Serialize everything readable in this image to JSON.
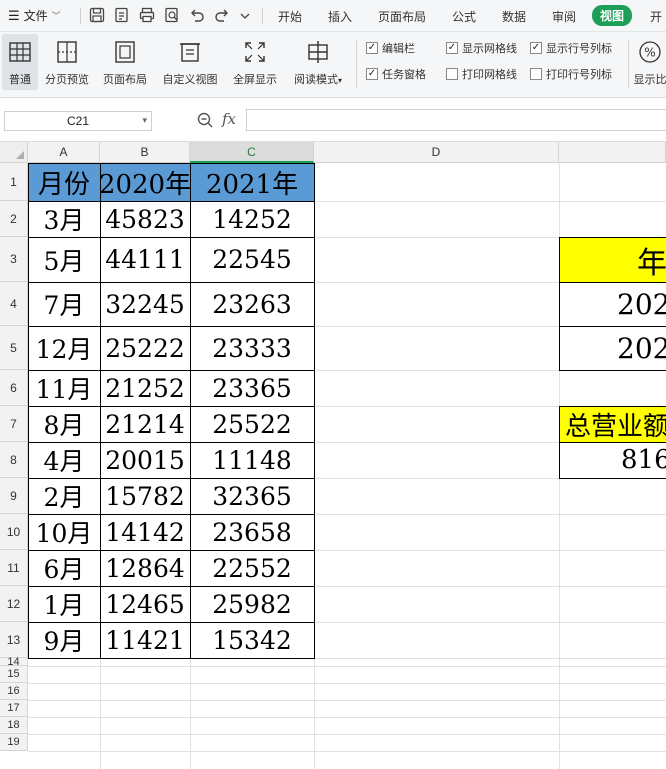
{
  "menubar": {
    "file_label": "文件",
    "tabs": [
      "开始",
      "插入",
      "页面布局",
      "公式",
      "数据",
      "审阅",
      "视图",
      "开"
    ],
    "active_tab": "视图"
  },
  "ribbon": {
    "buttons": [
      "普通",
      "分页预览",
      "页面布局",
      "自定义视图",
      "全屏显示",
      "阅读模式"
    ],
    "checks": [
      {
        "label": "编辑栏",
        "checked": true
      },
      {
        "label": "任务窗格",
        "checked": true
      },
      {
        "label": "显示网格线",
        "checked": true
      },
      {
        "label": "打印网格线",
        "checked": false
      },
      {
        "label": "显示行号列标",
        "checked": true
      },
      {
        "label": "打印行号列标",
        "checked": false
      }
    ],
    "zoom_label": "显示比"
  },
  "formula_bar": {
    "name_box": "C21",
    "fx": "fx",
    "formula": ""
  },
  "columns": [
    "A",
    "B",
    "C",
    "D"
  ],
  "rows": [
    "1",
    "2",
    "3",
    "4",
    "5",
    "6",
    "7",
    "8",
    "9",
    "10",
    "11",
    "12",
    "13",
    "14",
    "15",
    "16",
    "17",
    "18",
    "19"
  ],
  "table": {
    "headers": [
      "月份",
      "2020年",
      "2021年"
    ],
    "data": [
      [
        "3月",
        "45823",
        "14252"
      ],
      [
        "5月",
        "44111",
        "22545"
      ],
      [
        "7月",
        "32245",
        "23263"
      ],
      [
        "12月",
        "25222",
        "23333"
      ],
      [
        "11月",
        "21252",
        "23365"
      ],
      [
        "8月",
        "21214",
        "25522"
      ],
      [
        "4月",
        "20015",
        "11148"
      ],
      [
        "2月",
        "15782",
        "32365"
      ],
      [
        "10月",
        "14142",
        "23658"
      ],
      [
        "6月",
        "12864",
        "22552"
      ],
      [
        "1月",
        "12465",
        "25982"
      ],
      [
        "9月",
        "11421",
        "15342"
      ]
    ]
  },
  "right_panel": {
    "year_header": "年",
    "year_1": "202",
    "year_2": "202",
    "total_label": "总营业额",
    "total_value": "816"
  },
  "colors": {
    "header_fill": "#5b9bd5",
    "highlight_fill": "#ffff00",
    "active_tab": "#1f9e5a"
  }
}
